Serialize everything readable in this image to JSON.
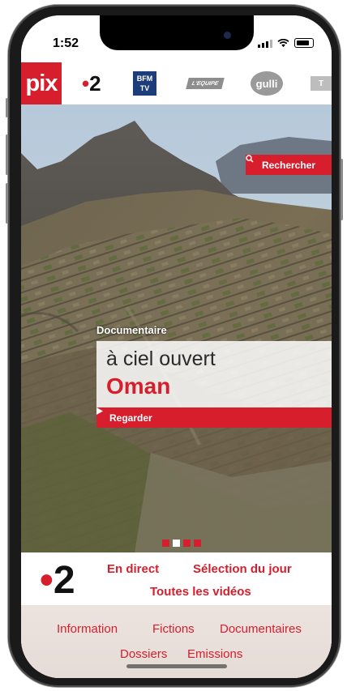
{
  "status": {
    "time": "1:52"
  },
  "brand": {
    "logo": "pix",
    "accent": "#d61e2c"
  },
  "channels": [
    {
      "name": "France 2",
      "label": "2"
    },
    {
      "name": "BFM TV",
      "label_line1": "BFM",
      "label_line2": "TV"
    },
    {
      "name": "L'Equipe",
      "label": "L'EQUIPE"
    },
    {
      "name": "Gulli",
      "label": "gulli"
    },
    {
      "name": "more",
      "label": "T"
    }
  ],
  "search": {
    "label": "Rechercher"
  },
  "featured": {
    "genre": "Documentaire",
    "title_line1": "à ciel ouvert",
    "title_line2": "Oman",
    "watch_label": "Regarder",
    "slides_total": 4,
    "slide_active": 2
  },
  "nav": {
    "channel_label": "2",
    "primary": [
      {
        "label": "En direct"
      },
      {
        "label": "Sélection du jour"
      },
      {
        "label": "Toutes les vidéos"
      }
    ],
    "secondary": [
      {
        "label": "Information"
      },
      {
        "label": "Fictions"
      },
      {
        "label": "Documentaires"
      },
      {
        "label": "Dossiers"
      },
      {
        "label": "Emissions"
      }
    ]
  }
}
